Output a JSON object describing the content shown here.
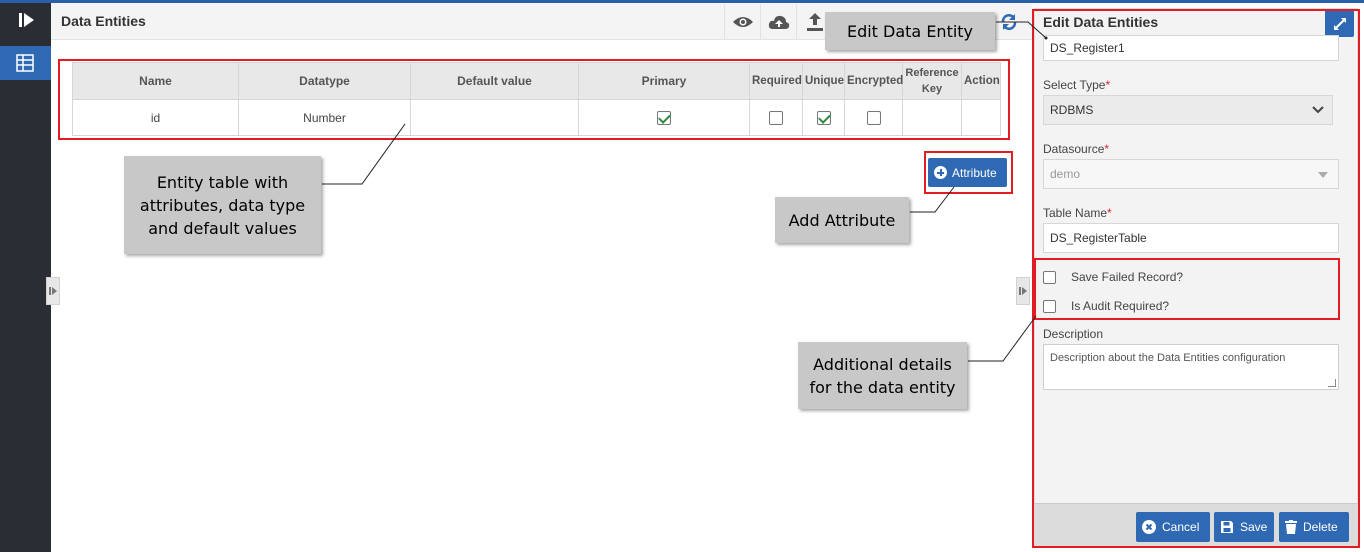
{
  "header": {
    "title": "Data Entities",
    "tools": [
      "eye-icon",
      "cloud-upload-icon",
      "upload-icon",
      "sync-icon"
    ]
  },
  "table": {
    "columns": [
      "Name",
      "Datatype",
      "Default value",
      "Primary",
      "Required",
      "Unique",
      "Encrypted",
      "Reference Key",
      "Action"
    ],
    "rows": [
      {
        "name": "id",
        "datatype": "Number",
        "default_value": "",
        "primary": true,
        "required": false,
        "unique": true,
        "encrypted": false,
        "reference_key": "",
        "action": ""
      }
    ]
  },
  "add_attribute_label": "Attribute",
  "panel": {
    "title": "Edit Data Entities",
    "entity_name": "DS_Register1",
    "select_type_label": "Select Type",
    "select_type_value": "RDBMS",
    "datasource_label": "Datasource",
    "datasource_value": "demo",
    "table_name_label": "Table Name",
    "table_name_value": "DS_RegisterTable",
    "required_mark": "*",
    "save_failed_label": "Save Failed Record?",
    "audit_label": "Is Audit Required?",
    "description_label": "Description",
    "description_value": "Description about the Data Entities configuration",
    "buttons": {
      "cancel": "Cancel",
      "save": "Save",
      "delete": "Delete"
    }
  },
  "callouts": {
    "edit_entity": "Edit Data Entity",
    "entity_table": "Entity table with attributes, data type and default values",
    "add_attribute": "Add Attribute",
    "additional": "Additional details for the data entity"
  },
  "colors": {
    "accent": "#2f69b3",
    "highlight": "#e31c24",
    "rail": "#2b2d35"
  }
}
